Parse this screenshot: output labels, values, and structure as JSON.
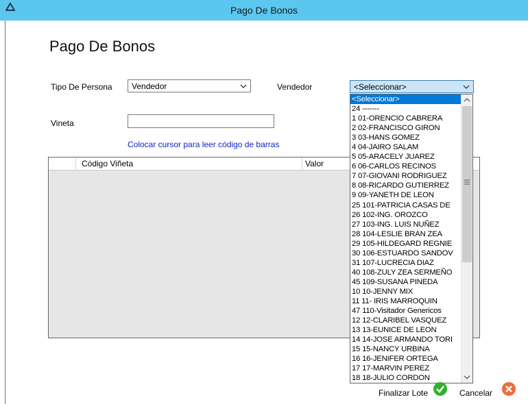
{
  "window": {
    "title": "Pago De Bonos"
  },
  "page": {
    "title": "Pago De Bonos"
  },
  "form": {
    "tipo_label": "Tipo De Persona",
    "tipo_value": "Vendedor",
    "vendedor_label": "Vendedor",
    "vendedor_value": "<Seleccionar>",
    "vineta_label": "Vineta",
    "vineta_value": "",
    "barcode_hint": "Colocar cursor para leer código de barras"
  },
  "grid": {
    "columns": [
      "",
      "Código Viñeta",
      "Valor"
    ]
  },
  "dropdown": {
    "items": [
      "<Seleccionar>",
      "24 -------",
      "1  01-ORENCIO CABRERA",
      "2  02-FRANCISCO GIRON",
      "3  03-HANS GOMEZ",
      "4  04-JAIRO SALAM",
      "5  05-ARACELY JUAREZ",
      "6  06-CARLOS RECINOS",
      "7  07-GIOVANI RODRIGUEZ",
      "8  08-RICARDO GUTIERREZ",
      "9  09-YANETH DE LEON",
      "25  101-PATRICIA CASAS DE",
      "26  102-ING. OROZCO",
      "27  103-ING. LUIS NUÑEZ",
      "28  104-LESLIE BRAN ZEA",
      "29  105-HILDEGARD REGNIE",
      "30  106-ESTUARDO SANDOV",
      "31  107-LUCRECIA DIAZ",
      "40  108-ZULY ZEA SERMEÑO",
      "45  109-SUSANA PINEDA",
      "10  10-JENNY MIX",
      "11  11- IRIS MARROQUIN",
      "47  110-Visitador Genericos",
      "12  12-CLARIBEL VASQUEZ",
      "13  13-EUNICE DE LEON",
      "14  14-JOSE ARMANDO TORI",
      "15  15-NANCY URBINA",
      "16  16-JENIFER ORTEGA",
      "17  17-MARVIN PEREZ",
      "18  18-JULIO CORDON"
    ]
  },
  "buttons": {
    "finalizar": "Finalizar Lote",
    "cancelar": "Cancelar"
  },
  "colors": {
    "titlebar": "#5bc7ef",
    "hint_link": "#0b24c5",
    "selection": "#0078d7",
    "ok_green": "#2fb12f",
    "cancel_orange": "#f26a3a"
  },
  "icons": {
    "app": "app-icon",
    "combo_arrow": "chevron-down-icon",
    "ok": "checkmark-icon",
    "cancel": "close-icon"
  }
}
